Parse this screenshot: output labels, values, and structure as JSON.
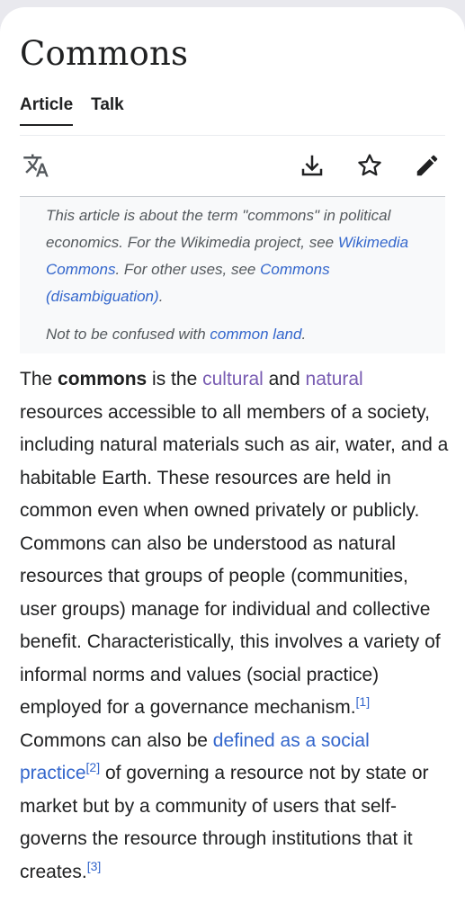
{
  "page": {
    "title": "Commons",
    "tabs": [
      {
        "label": "Article",
        "active": true
      },
      {
        "label": "Talk",
        "active": false
      }
    ]
  },
  "toolbar": {
    "icons": [
      "language-icon",
      "download-icon",
      "star-icon",
      "edit-pencil-icon"
    ]
  },
  "hatnote": {
    "line1_pre": "This article is about the term \"commons\" in political economics. For the Wikimedia project, see ",
    "link1": "Wikimedia Commons",
    "line1_mid": ". For other uses, see ",
    "link2": "Commons (disambiguation)",
    "line1_end": ".",
    "line2_pre": "Not to be confused with ",
    "link3": "common land",
    "line2_end": "."
  },
  "article": {
    "t1": "The ",
    "bold": "commons",
    "t2": " is the ",
    "link_cultural": "cultural",
    "t3": " and ",
    "link_natural": "natural",
    "t4": " resources accessible to all members of a society, including natural materials such as air, water, and a habitable Earth. These resources are held in common even when owned privately or publicly. Commons can also be understood as natural resources that groups of people (communities, user groups) manage for individual and collective benefit. Characteristically, this involves a variety of informal norms and values (social practice) employed for a governance mechanism.",
    "ref1": "[1]",
    "t5": " Commons can also be ",
    "link_defined": "defined as a social practice",
    "ref2": "[2]",
    "t6": " of governing a resource not by state or market but by a community of users that self-governs the resource through institutions that it creates.",
    "ref3": "[3]"
  },
  "colors": {
    "link": "#3366cc",
    "visited_link": "#795cb2",
    "text": "#202122",
    "hatnote_bg": "#f8f9fa"
  }
}
